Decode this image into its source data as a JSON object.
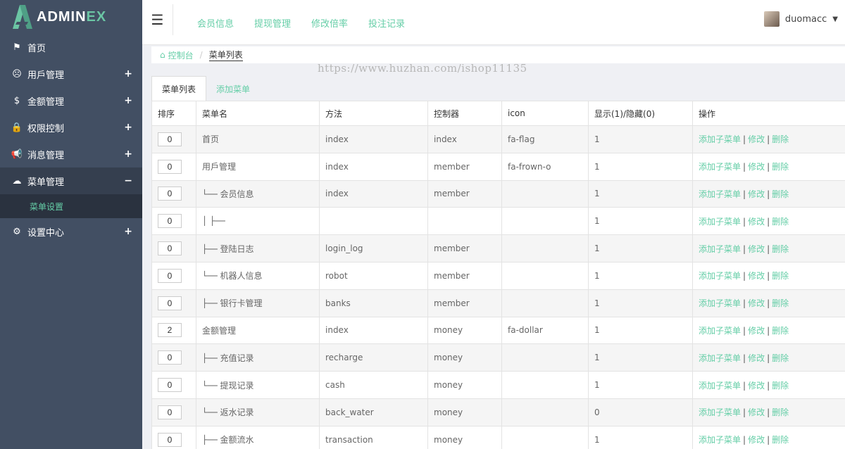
{
  "logo": {
    "text_main": "ADMIN",
    "text_accent": "EX"
  },
  "sidebar": {
    "items": [
      {
        "label": "首页",
        "icon": "flag-icon",
        "glyph": "⚑",
        "toggle": ""
      },
      {
        "label": "用戶管理",
        "icon": "frown-icon",
        "glyph": "☹",
        "toggle": "+"
      },
      {
        "label": "金额管理",
        "icon": "dollar-icon",
        "glyph": "$",
        "toggle": "+"
      },
      {
        "label": "权限控制",
        "icon": "lock-icon",
        "glyph": "🔒",
        "toggle": "+"
      },
      {
        "label": "消息管理",
        "icon": "bullhorn-icon",
        "glyph": "📢",
        "toggle": "+"
      },
      {
        "label": "菜单管理",
        "icon": "cloud-icon",
        "glyph": "☁",
        "toggle": "−"
      }
    ],
    "sub_item": "菜单设置",
    "last_item": {
      "label": "设置中心",
      "icon": "gear-icon",
      "glyph": "⚙",
      "toggle": "+"
    }
  },
  "topbar": {
    "links": [
      "会员信息",
      "提现管理",
      "修改倍率",
      "投注记录"
    ],
    "username": "duomacc"
  },
  "breadcrumb": {
    "home": "控制台",
    "current": "菜单列表"
  },
  "watermark": "https://www.huzhan.com/ishop11135",
  "tabs": {
    "active": "菜单列表",
    "inactive": "添加菜单"
  },
  "table": {
    "headers": [
      "排序",
      "菜单名",
      "方法",
      "控制器",
      "icon",
      "显示(1)/隐藏(0)",
      "操作"
    ],
    "ops": {
      "add": "添加子菜单",
      "edit": "修改",
      "delete": "删除",
      "sep": "|"
    },
    "rows": [
      {
        "sort": "0",
        "name": "首页",
        "method": "index",
        "controller": "index",
        "icon": "fa-flag",
        "show": "1"
      },
      {
        "sort": "0",
        "name": "用戶管理",
        "method": "index",
        "controller": "member",
        "icon": "fa-frown-o",
        "show": "1"
      },
      {
        "sort": "0",
        "name": "└── 会员信息",
        "method": "index",
        "controller": "member",
        "icon": "",
        "show": "1"
      },
      {
        "sort": "0",
        "name": "│   ├──",
        "method": "",
        "controller": "",
        "icon": "",
        "show": "1"
      },
      {
        "sort": "0",
        "name": "├── 登陆日志",
        "method": "login_log",
        "controller": "member",
        "icon": "",
        "show": "1"
      },
      {
        "sort": "0",
        "name": "└── 机器人信息",
        "method": "robot",
        "controller": "member",
        "icon": "",
        "show": "1"
      },
      {
        "sort": "0",
        "name": "├── 银行卡管理",
        "method": "banks",
        "controller": "member",
        "icon": "",
        "show": "1"
      },
      {
        "sort": "2",
        "name": "金额管理",
        "method": "index",
        "controller": "money",
        "icon": "fa-dollar",
        "show": "1"
      },
      {
        "sort": "0",
        "name": "├── 充值记录",
        "method": "recharge",
        "controller": "money",
        "icon": "",
        "show": "1"
      },
      {
        "sort": "0",
        "name": "└── 提现记录",
        "method": "cash",
        "controller": "money",
        "icon": "",
        "show": "1"
      },
      {
        "sort": "0",
        "name": "└── 返水记录",
        "method": "back_water",
        "controller": "money",
        "icon": "",
        "show": "0"
      },
      {
        "sort": "0",
        "name": "├── 金额流水",
        "method": "transaction",
        "controller": "money",
        "icon": "",
        "show": "1"
      }
    ]
  }
}
